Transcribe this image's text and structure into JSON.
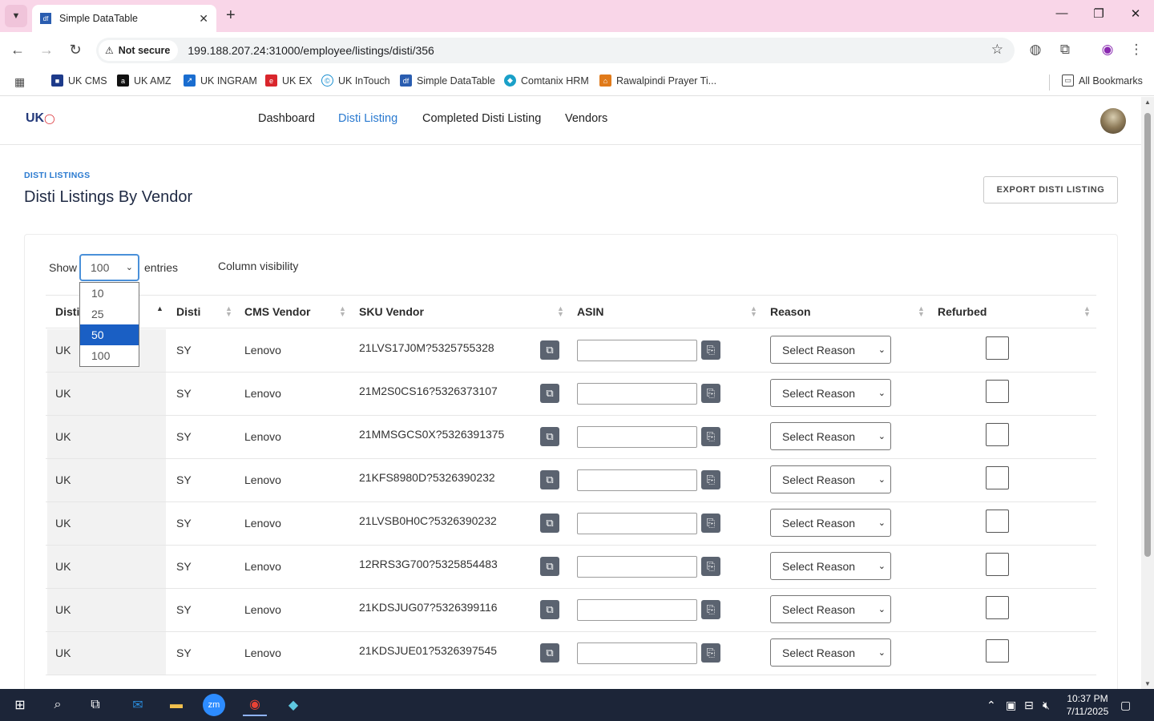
{
  "browser": {
    "tab_title": "Simple DataTable",
    "tab_favicon": "df",
    "security_label": "Not secure",
    "url": "199.188.207.24:31000/employee/listings/disti/356",
    "bookmarks": [
      {
        "label": "UK CMS",
        "color": "#1d3a8a"
      },
      {
        "label": "UK AMZ",
        "color": "#111111"
      },
      {
        "label": "UK INGRAM",
        "color": "#1a6dd0"
      },
      {
        "label": "UK EX",
        "color": "#d9262c"
      },
      {
        "label": "UK InTouch",
        "color": "#1a8fd0"
      },
      {
        "label": "Simple DataTable",
        "color": "#2a5db0"
      },
      {
        "label": "Comtanix HRM",
        "color": "#1aa0c8"
      },
      {
        "label": "Rawalpindi Prayer Ti...",
        "color": "#e07a1a"
      }
    ],
    "all_bookmarks": "All Bookmarks"
  },
  "nav": {
    "logo": "UK",
    "links": [
      "Dashboard",
      "Disti Listing",
      "Completed Disti Listing",
      "Vendors"
    ],
    "active_link": "Disti Listing"
  },
  "page": {
    "breadcrumb": "DISTI LISTINGS",
    "title": "Disti Listings By Vendor",
    "export_button": "EXPORT DISTI LISTING"
  },
  "controls": {
    "show_label": "Show",
    "entries_label": "entries",
    "length_value": "100",
    "length_options": [
      "10",
      "25",
      "50",
      "100"
    ],
    "highlighted_option": "50",
    "column_visibility": "Column visibility"
  },
  "table": {
    "headers": [
      "Disti",
      "Disti",
      "CMS Vendor",
      "SKU Vendor",
      "ASIN",
      "Reason",
      "Refurbed"
    ],
    "reason_placeholder": "Select Reason",
    "rows": [
      {
        "col0": "UK",
        "disti": "SY",
        "vendor": "Lenovo",
        "sku": "21LVS17J0M?5325755328"
      },
      {
        "col0": "UK",
        "disti": "SY",
        "vendor": "Lenovo",
        "sku": "21M2S0CS16?5326373107"
      },
      {
        "col0": "UK",
        "disti": "SY",
        "vendor": "Lenovo",
        "sku": "21MMSGCS0X?5326391375"
      },
      {
        "col0": "UK",
        "disti": "SY",
        "vendor": "Lenovo",
        "sku": "21KFS8980D?5326390232"
      },
      {
        "col0": "UK",
        "disti": "SY",
        "vendor": "Lenovo",
        "sku": "21LVSB0H0C?5326390232"
      },
      {
        "col0": "UK",
        "disti": "SY",
        "vendor": "Lenovo",
        "sku": "12RRS3G700?5325854483"
      },
      {
        "col0": "UK",
        "disti": "SY",
        "vendor": "Lenovo",
        "sku": "21KDSJUG07?5326399116"
      },
      {
        "col0": "UK",
        "disti": "SY",
        "vendor": "Lenovo",
        "sku": "21KDSJUE01?5326397545"
      }
    ]
  },
  "taskbar": {
    "time": "10:37 PM",
    "date": "7/11/2025"
  }
}
